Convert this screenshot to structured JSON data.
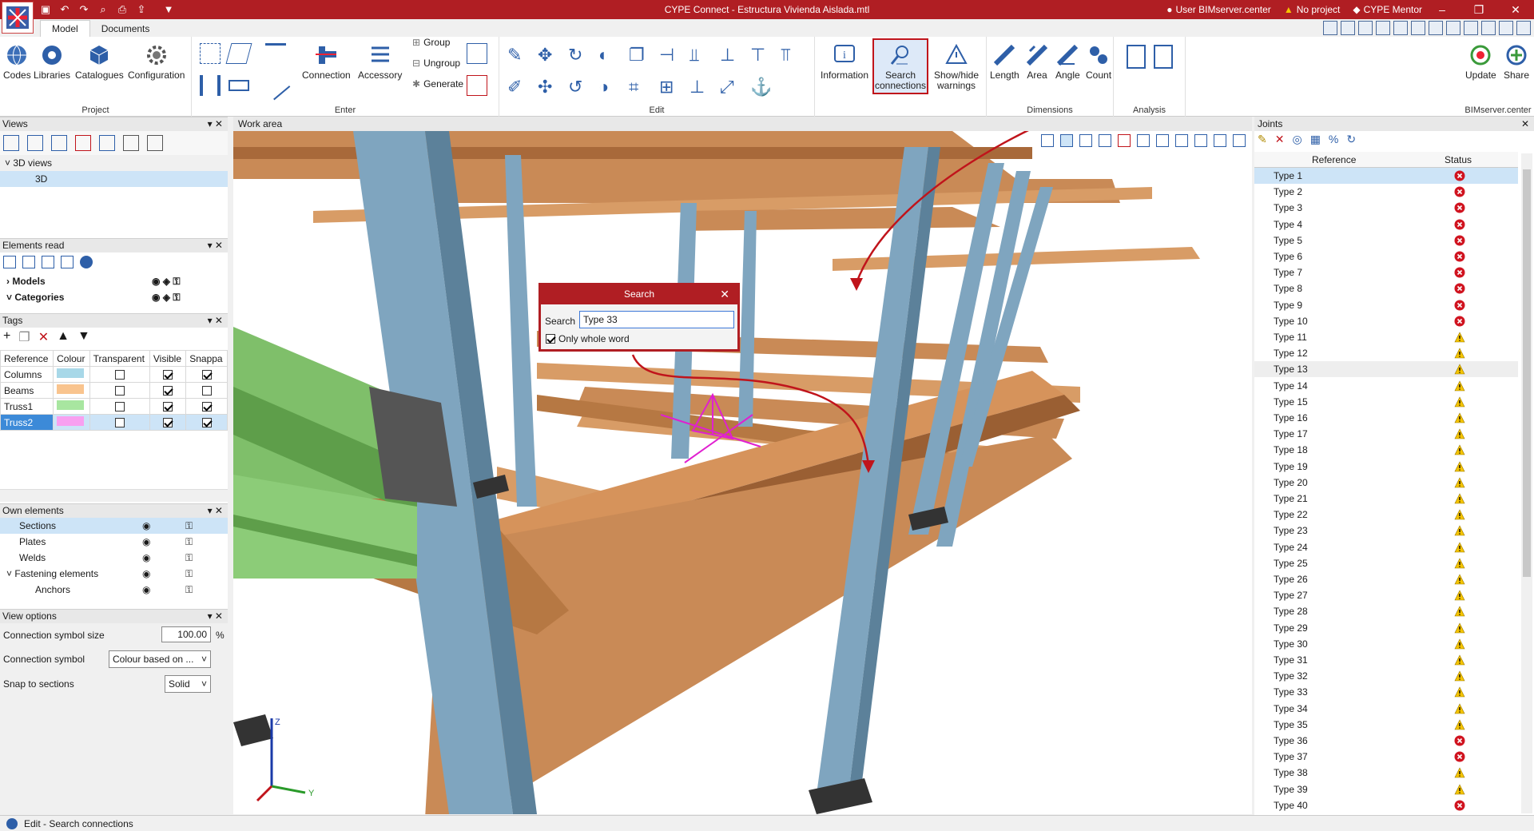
{
  "window": {
    "title": "CYPE Connect - Estructura Vivienda Aislada.mtl",
    "user": "User BIMserver.center",
    "project": "No project",
    "mentor": "CYPE Mentor"
  },
  "tabs": [
    "Model",
    "Documents"
  ],
  "ribbon": {
    "project": {
      "label": "Project",
      "buttons": [
        "Codes",
        "Libraries",
        "Catalogues",
        "Configuration"
      ]
    },
    "enter": {
      "label": "Enter",
      "buttons": [
        "Connection",
        "Accessory"
      ],
      "small": [
        "Group",
        "Ungroup",
        "Generate"
      ]
    },
    "edit": {
      "label": "Edit"
    },
    "info": {
      "information": "Information",
      "search_l1": "Search",
      "search_l2": "connections",
      "show_l1": "Show/hide",
      "show_l2": "warnings"
    },
    "dimensions": {
      "label": "Dimensions",
      "buttons": [
        "Length",
        "Area",
        "Angle",
        "Count"
      ]
    },
    "analysis": {
      "label": "Analysis"
    },
    "bim": {
      "label": "BIMserver.center",
      "buttons": [
        "Update",
        "Share"
      ]
    }
  },
  "views": {
    "title": "Views",
    "tree_root": "3D views",
    "tree_child": "3D"
  },
  "elements_read": {
    "title": "Elements read",
    "items": [
      "Models",
      "Categories"
    ]
  },
  "tags": {
    "title": "Tags",
    "headers": [
      "Reference",
      "Colour",
      "Transparent",
      "Visible",
      "Snappa"
    ],
    "rows": [
      {
        "name": "Columns",
        "color": "#a8d8e8",
        "transparent": false,
        "visible": true,
        "snap": true
      },
      {
        "name": "Beams",
        "color": "#f9c48e",
        "transparent": false,
        "visible": true,
        "snap": false
      },
      {
        "name": "Truss1",
        "color": "#a8e6a0",
        "transparent": false,
        "visible": true,
        "snap": true
      },
      {
        "name": "Truss2",
        "color": "#f8a0f0",
        "transparent": false,
        "visible": true,
        "snap": true
      }
    ]
  },
  "own_elements": {
    "title": "Own elements",
    "items": [
      "Sections",
      "Plates",
      "Welds",
      "Fastening elements",
      "Anchors"
    ]
  },
  "view_options": {
    "title": "View options",
    "size_label": "Connection symbol size",
    "size_value": "100.00",
    "size_unit": "%",
    "symbol_label": "Connection symbol",
    "symbol_value": "Colour based on ...",
    "snap_label": "Snap to sections",
    "snap_value": "Solid"
  },
  "work_area": {
    "title": "Work area"
  },
  "search_dialog": {
    "title": "Search",
    "label": "Search",
    "value": "Type 33",
    "whole_word": "Only whole word"
  },
  "joints": {
    "title": "Joints",
    "col_ref": "Reference",
    "col_status": "Status",
    "rows": [
      {
        "ref": "Type 1",
        "status": "error"
      },
      {
        "ref": "Type 2",
        "status": "error"
      },
      {
        "ref": "Type 3",
        "status": "error"
      },
      {
        "ref": "Type 4",
        "status": "error"
      },
      {
        "ref": "Type 5",
        "status": "error"
      },
      {
        "ref": "Type 6",
        "status": "error"
      },
      {
        "ref": "Type 7",
        "status": "error"
      },
      {
        "ref": "Type 8",
        "status": "error"
      },
      {
        "ref": "Type 9",
        "status": "error"
      },
      {
        "ref": "Type 10",
        "status": "error"
      },
      {
        "ref": "Type 11",
        "status": "warning"
      },
      {
        "ref": "Type 12",
        "status": "warning"
      },
      {
        "ref": "Type 13",
        "status": "warning"
      },
      {
        "ref": "Type 14",
        "status": "warning"
      },
      {
        "ref": "Type 15",
        "status": "warning"
      },
      {
        "ref": "Type 16",
        "status": "warning"
      },
      {
        "ref": "Type 17",
        "status": "warning"
      },
      {
        "ref": "Type 18",
        "status": "warning"
      },
      {
        "ref": "Type 19",
        "status": "warning"
      },
      {
        "ref": "Type 20",
        "status": "warning"
      },
      {
        "ref": "Type 21",
        "status": "warning"
      },
      {
        "ref": "Type 22",
        "status": "warning"
      },
      {
        "ref": "Type 23",
        "status": "warning"
      },
      {
        "ref": "Type 24",
        "status": "warning"
      },
      {
        "ref": "Type 25",
        "status": "warning"
      },
      {
        "ref": "Type 26",
        "status": "warning"
      },
      {
        "ref": "Type 27",
        "status": "warning"
      },
      {
        "ref": "Type 28",
        "status": "warning"
      },
      {
        "ref": "Type 29",
        "status": "warning"
      },
      {
        "ref": "Type 30",
        "status": "warning"
      },
      {
        "ref": "Type 31",
        "status": "warning"
      },
      {
        "ref": "Type 32",
        "status": "warning"
      },
      {
        "ref": "Type 33",
        "status": "warning"
      },
      {
        "ref": "Type 34",
        "status": "warning"
      },
      {
        "ref": "Type 35",
        "status": "warning"
      },
      {
        "ref": "Type 36",
        "status": "error"
      },
      {
        "ref": "Type 37",
        "status": "error"
      },
      {
        "ref": "Type 38",
        "status": "warning"
      },
      {
        "ref": "Type 39",
        "status": "warning"
      },
      {
        "ref": "Type 40",
        "status": "error"
      }
    ]
  },
  "statusbar": {
    "text": "Edit - Search connections"
  },
  "colors": {
    "brand": "#b01e23",
    "selection": "#cde4f7",
    "error": "#d0131f",
    "warning": "#f5c400"
  }
}
